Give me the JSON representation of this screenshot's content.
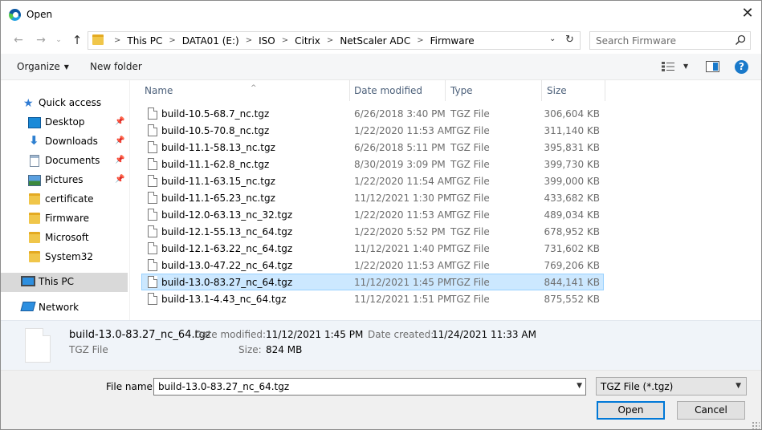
{
  "window": {
    "title": "Open",
    "close_glyph": "✕"
  },
  "address": {
    "breadcrumbs": [
      "This PC",
      "DATA01 (E:)",
      "ISO",
      "Citrix",
      "NetScaler ADC",
      "Firmware"
    ],
    "search_placeholder": "Search Firmware"
  },
  "toolbar": {
    "organize_label": "Organize",
    "new_folder_label": "New folder",
    "help_glyph": "?"
  },
  "sidebar": {
    "items": [
      {
        "label": "Quick access",
        "icon": "star-icon",
        "pinned": false
      },
      {
        "label": "Desktop",
        "icon": "desktop-icon",
        "pinned": true
      },
      {
        "label": "Downloads",
        "icon": "downloads-icon",
        "pinned": true
      },
      {
        "label": "Documents",
        "icon": "documents-icon",
        "pinned": true
      },
      {
        "label": "Pictures",
        "icon": "pictures-icon",
        "pinned": true
      },
      {
        "label": "certificate",
        "icon": "folder-icon",
        "pinned": false
      },
      {
        "label": "Firmware",
        "icon": "folder-icon",
        "pinned": false
      },
      {
        "label": "Microsoft",
        "icon": "folder-icon",
        "pinned": false
      },
      {
        "label": "System32",
        "icon": "folder-icon",
        "pinned": false
      },
      {
        "label": "This PC",
        "icon": "this-pc-icon",
        "pinned": false,
        "selected": true
      },
      {
        "label": "Network",
        "icon": "network-icon",
        "pinned": false
      }
    ]
  },
  "columns": {
    "name": "Name",
    "date": "Date modified",
    "type": "Type",
    "size": "Size"
  },
  "files": [
    {
      "name": "build-10.5-68.7_nc.tgz",
      "date": "6/26/2018 3:40 PM",
      "type": "TGZ File",
      "size": "306,604 KB"
    },
    {
      "name": "build-10.5-70.8_nc.tgz",
      "date": "1/22/2020 11:53 AM",
      "type": "TGZ File",
      "size": "311,140 KB"
    },
    {
      "name": "build-11.1-58.13_nc.tgz",
      "date": "6/26/2018 5:11 PM",
      "type": "TGZ File",
      "size": "395,831 KB"
    },
    {
      "name": "build-11.1-62.8_nc.tgz",
      "date": "8/30/2019 3:09 PM",
      "type": "TGZ File",
      "size": "399,730 KB"
    },
    {
      "name": "build-11.1-63.15_nc.tgz",
      "date": "1/22/2020 11:54 AM",
      "type": "TGZ File",
      "size": "399,000 KB"
    },
    {
      "name": "build-11.1-65.23_nc.tgz",
      "date": "11/12/2021 1:30 PM",
      "type": "TGZ File",
      "size": "433,682 KB"
    },
    {
      "name": "build-12.0-63.13_nc_32.tgz",
      "date": "1/22/2020 11:53 AM",
      "type": "TGZ File",
      "size": "489,034 KB"
    },
    {
      "name": "build-12.1-55.13_nc_64.tgz",
      "date": "1/22/2020 5:52 PM",
      "type": "TGZ File",
      "size": "678,952 KB"
    },
    {
      "name": "build-12.1-63.22_nc_64.tgz",
      "date": "11/12/2021 1:40 PM",
      "type": "TGZ File",
      "size": "731,602 KB"
    },
    {
      "name": "build-13.0-47.22_nc_64.tgz",
      "date": "1/22/2020 11:53 AM",
      "type": "TGZ File",
      "size": "769,206 KB"
    },
    {
      "name": "build-13.0-83.27_nc_64.tgz",
      "date": "11/12/2021 1:45 PM",
      "type": "TGZ File",
      "size": "844,141 KB",
      "selected": true
    },
    {
      "name": "build-13.1-4.43_nc_64.tgz",
      "date": "11/12/2021 1:51 PM",
      "type": "TGZ File",
      "size": "875,552 KB"
    }
  ],
  "details": {
    "name": "build-13.0-83.27_nc_64.tgz",
    "type": "TGZ File",
    "modified_label": "Date modified:",
    "modified_value": "11/12/2021 1:45 PM",
    "created_label": "Date created:",
    "created_value": "11/24/2021 11:33 AM",
    "size_label": "Size:",
    "size_value": "824 MB"
  },
  "bottom": {
    "filename_label": "File name:",
    "filename_value": "build-13.0-83.27_nc_64.tgz",
    "filetype_value": "TGZ File (*.tgz)",
    "open_label": "Open",
    "cancel_label": "Cancel"
  }
}
